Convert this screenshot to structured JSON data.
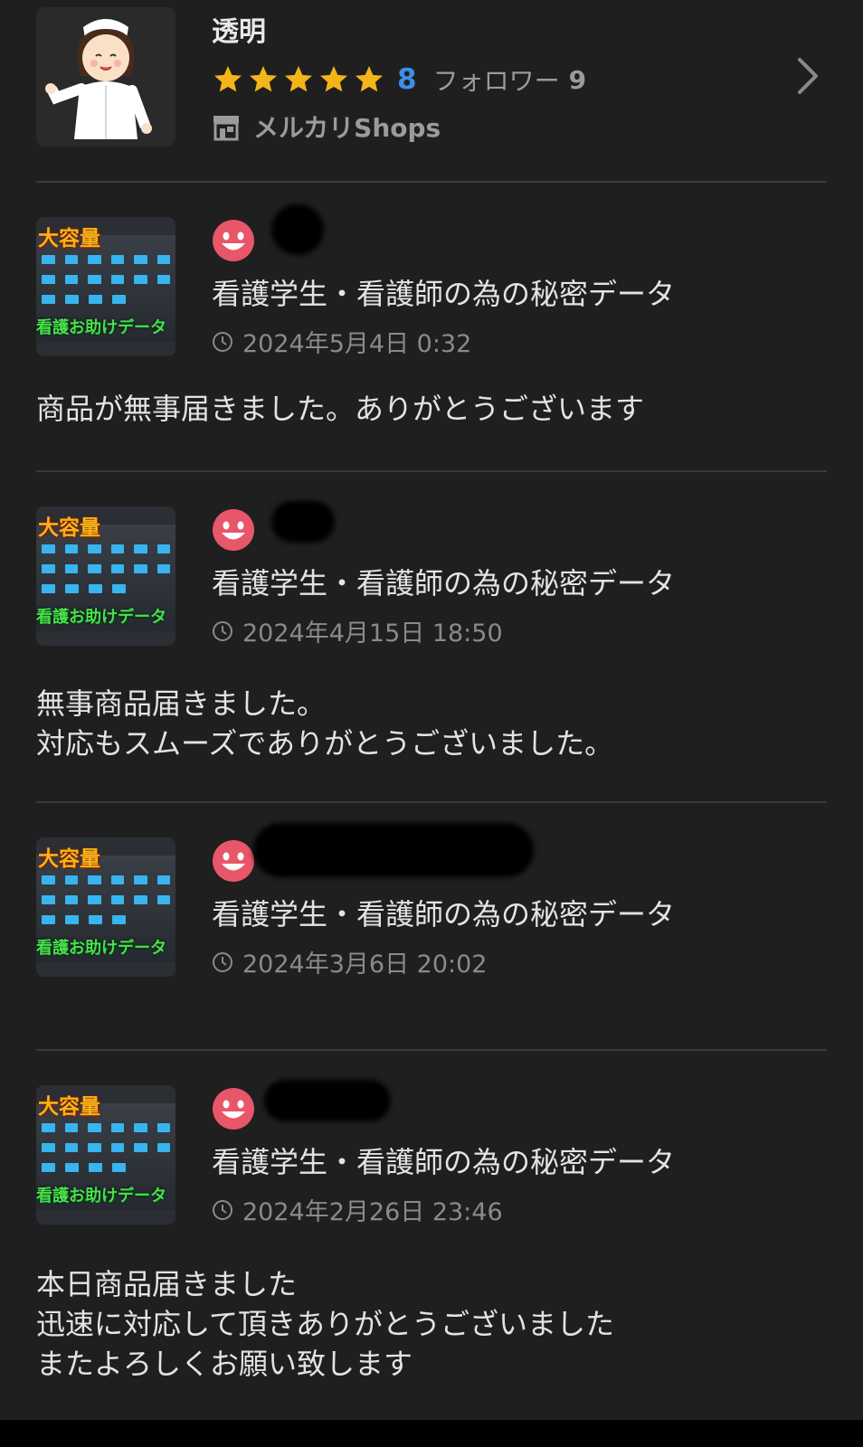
{
  "seller": {
    "name": "透明",
    "rating_stars": 5,
    "rating_count": "8",
    "followers_label": "フォロワー",
    "followers_count": "9",
    "shops_label": "メルカリShops",
    "avatar_icon": "nurse-avatar",
    "star_color": "#f4b41a",
    "accent_color": "#3b8fe8"
  },
  "reviews": [
    {
      "product": "看護学生・看護師の為の秘密データ",
      "timestamp": "2024年5月4日 0:32",
      "comment": "商品が無事届きました。ありがとうございます",
      "thumb_title": "大容量",
      "thumb_sub": "看護お助けデータ"
    },
    {
      "product": "看護学生・看護師の為の秘密データ",
      "timestamp": "2024年4月15日 18:50",
      "comment": "無事商品届きました。\n対応もスムーズでありがとうございました。",
      "thumb_title": "大容量",
      "thumb_sub": "看護お助けデータ"
    },
    {
      "product": "看護学生・看護師の為の秘密データ",
      "timestamp": "2024年3月6日 20:02",
      "comment": "",
      "thumb_title": "大容量",
      "thumb_sub": "看護お助けデータ"
    },
    {
      "product": "看護学生・看護師の為の秘密データ",
      "timestamp": "2024年2月26日 23:46",
      "comment": "本日商品届きました\n迅速に対応して頂きありがとうございました\nまたよろしくお願い致します",
      "thumb_title": "大容量",
      "thumb_sub": "看護お助けデータ"
    }
  ],
  "review_face_icon": "smile-face-icon",
  "review_face_color": "#e8566a"
}
